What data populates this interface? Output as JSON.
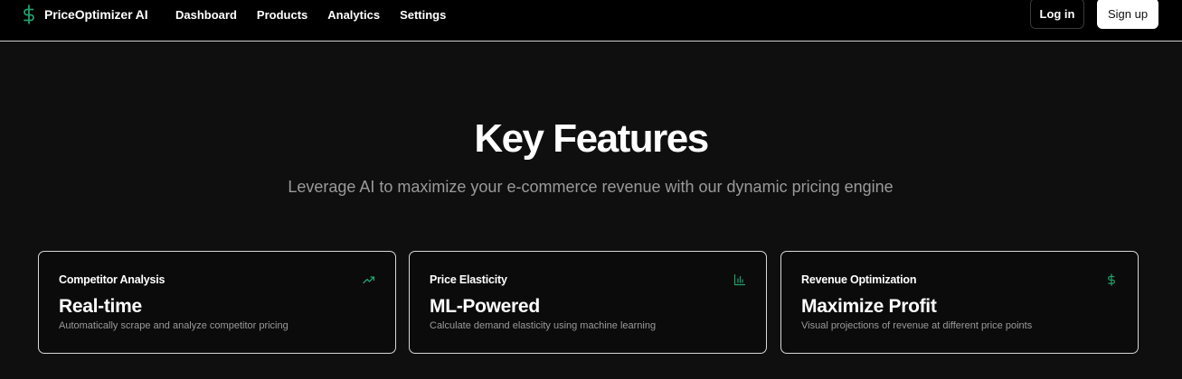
{
  "nav": {
    "brand": "PriceOptimizer AI",
    "links": [
      "Dashboard",
      "Products",
      "Analytics",
      "Settings"
    ],
    "login": "Log in",
    "signup": "Sign up"
  },
  "hero": {
    "title": "Key Features",
    "subtitle": "Leverage AI to maximize your e-commerce revenue with our dynamic pricing engine"
  },
  "features": [
    {
      "label": "Competitor Analysis",
      "value": "Real-time",
      "description": "Automatically scrape and analyze competitor pricing",
      "icon": "trending-up-icon"
    },
    {
      "label": "Price Elasticity",
      "value": "ML-Powered",
      "description": "Calculate demand elasticity using machine learning",
      "icon": "bar-chart-icon"
    },
    {
      "label": "Revenue Optimization",
      "value": "Maximize Profit",
      "description": "Visual projections of revenue at different price points",
      "icon": "dollar-sign-icon"
    }
  ],
  "colors": {
    "accent": "#22a06b",
    "background": "#0f0f0f",
    "nav_background": "#000000",
    "muted_text": "#9a9a9a"
  }
}
